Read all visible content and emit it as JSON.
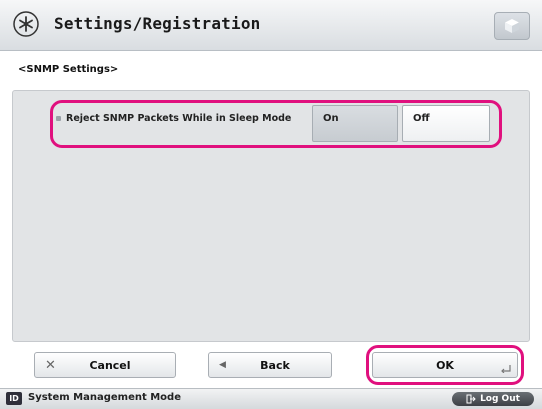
{
  "header": {
    "title": "Settings/Registration",
    "icon": "settings-gear-icon",
    "right_button_icon": "cube-icon"
  },
  "breadcrumb": "<SNMP Settings>",
  "setting": {
    "label": "Reject SNMP Packets While in Sleep Mode",
    "options": [
      "On",
      "Off"
    ],
    "selected": "On"
  },
  "buttons": {
    "cancel": "Cancel",
    "back": "Back",
    "ok": "OK"
  },
  "statusbar": {
    "id_badge": "ID",
    "mode": "System Management Mode",
    "logout": "Log Out"
  },
  "colors": {
    "highlight": "#e0107e"
  }
}
